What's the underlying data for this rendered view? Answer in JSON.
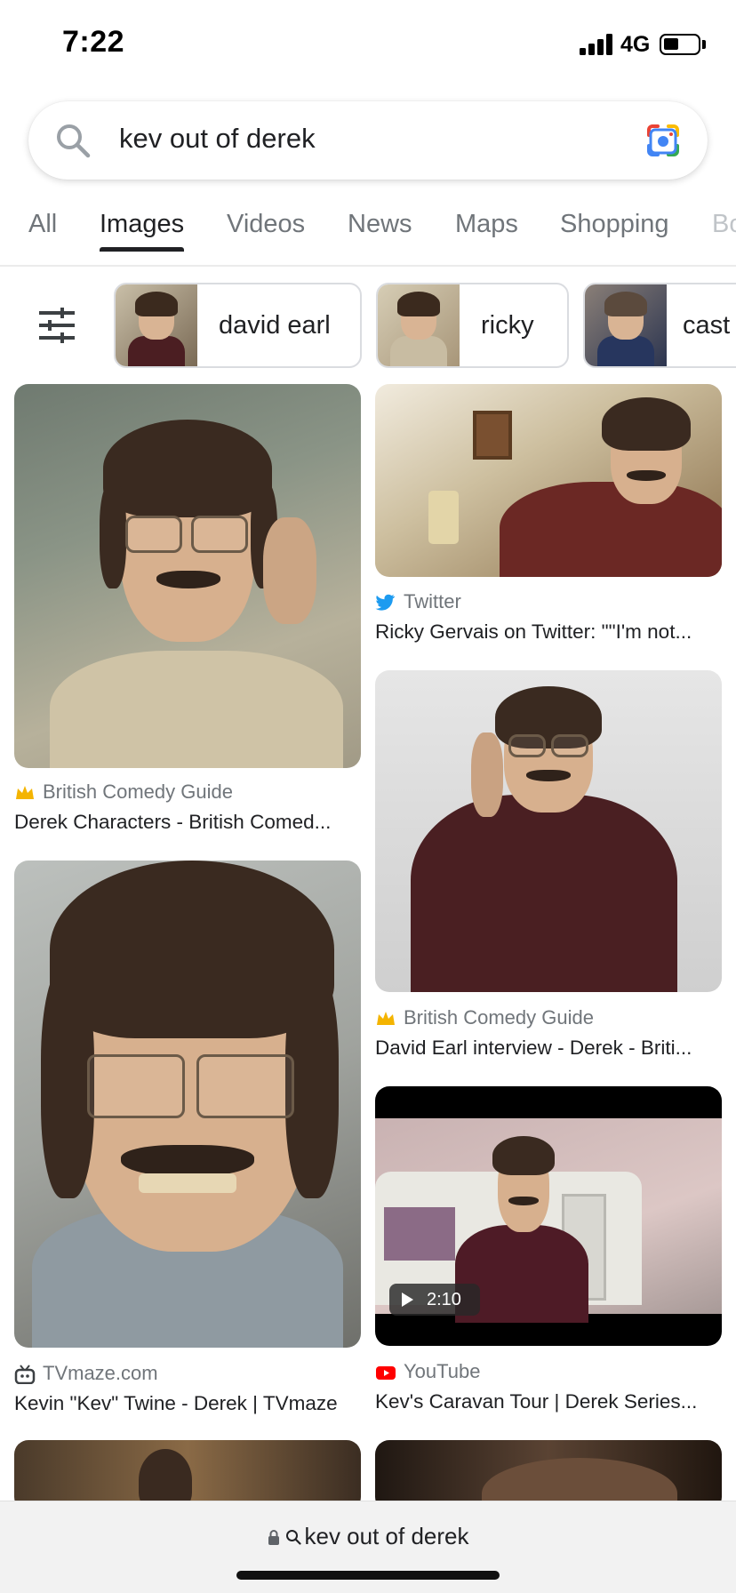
{
  "status_bar": {
    "time": "7:22",
    "network": "4G"
  },
  "search": {
    "query": "kev out of derek"
  },
  "tabs": [
    {
      "label": "All",
      "active": false
    },
    {
      "label": "Images",
      "active": true
    },
    {
      "label": "Videos",
      "active": false
    },
    {
      "label": "News",
      "active": false
    },
    {
      "label": "Maps",
      "active": false
    },
    {
      "label": "Shopping",
      "active": false
    },
    {
      "label": "Bo",
      "active": false
    }
  ],
  "chips": [
    {
      "label": "david earl"
    },
    {
      "label": "ricky"
    },
    {
      "label": "cast"
    }
  ],
  "results": [
    {
      "source": "British Comedy Guide",
      "source_icon": "crown-icon",
      "title": "Derek Characters - British Comed..."
    },
    {
      "source": "Twitter",
      "source_icon": "twitter-bird-icon",
      "title": "Ricky Gervais on Twitter: \"\"I'm not..."
    },
    {
      "source": "British Comedy Guide",
      "source_icon": "crown-icon",
      "title": "David Earl interview - Derek - Briti..."
    },
    {
      "source": "TVmaze.com",
      "source_icon": "tv-icon",
      "title": "Kevin \"Kev\" Twine - Derek | TVmaze"
    },
    {
      "source": "YouTube",
      "source_icon": "youtube-icon",
      "title": "Kev's Caravan Tour | Derek Series...",
      "duration": "2:10"
    }
  ],
  "address_bar": {
    "text": "kev out of derek"
  },
  "colors": {
    "twitter": "#1d9bf0",
    "youtube": "#ff0000",
    "crown": "#f4b400",
    "text": "#202124",
    "muted": "#70757a"
  }
}
